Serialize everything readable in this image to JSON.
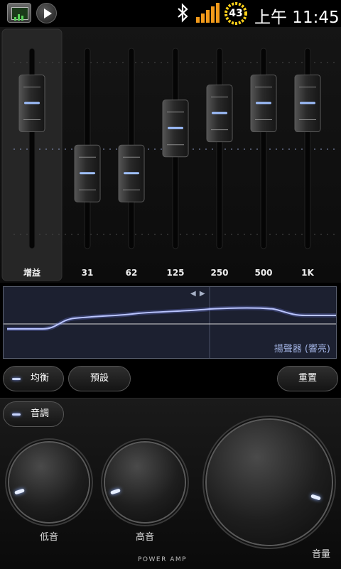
{
  "status_bar": {
    "battery_level": "43",
    "time": "上午 11:45",
    "icons": [
      "app-icon",
      "play-icon",
      "bluetooth-icon",
      "signal-icon",
      "battery-icon"
    ],
    "colors": {
      "signal": "#f29a1a",
      "battery_ring": "#ffd21a"
    }
  },
  "equalizer": {
    "gain_label": "增益",
    "accent_color": "#9fc0ff"
  },
  "chart_data": {
    "type": "bar",
    "categories": [
      "增益",
      "31",
      "62",
      "125",
      "250",
      "500",
      "1K"
    ],
    "values": [
      0.45,
      -0.25,
      -0.25,
      0.2,
      0.35,
      0.45,
      0.45
    ],
    "ylim": [
      -1,
      1
    ],
    "grid": true
  },
  "graph": {
    "caption": "揚聲器 (響亮)",
    "arrows": "◀ ▶",
    "line_color": "#c8d4ff"
  },
  "buttons": {
    "balance": "均衡",
    "preset": "預設",
    "reset": "重置",
    "tone": "音調"
  },
  "tone": {
    "bass_label": "低音",
    "treble_label": "高音",
    "volume_label": "音量",
    "bass_level": 0.1,
    "treble_level": 0.1,
    "volume_level": 0.9
  },
  "brand": "POWER AMP"
}
